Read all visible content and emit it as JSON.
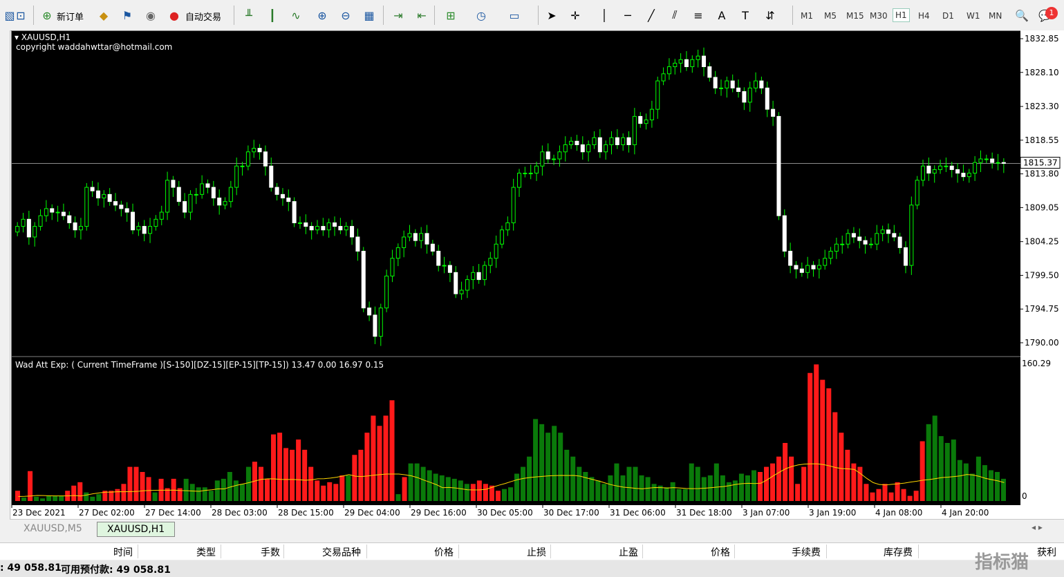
{
  "toolbar": {
    "new_order": "新订单",
    "auto_trade": "自动交易",
    "timeframes": [
      "M1",
      "M5",
      "M15",
      "M30",
      "H1",
      "H4",
      "D1",
      "W1",
      "MN"
    ],
    "active_timeframe": "H1",
    "notification_count": "1"
  },
  "chart": {
    "symbol": "XAUUSD,H1",
    "copyright": "copyright waddahwttar@hotmail.com",
    "current_price": "1815.37",
    "price_ticks": [
      "1832.85",
      "1828.10",
      "1823.30",
      "1818.55",
      "1813.80",
      "1809.05",
      "1804.25",
      "1799.50",
      "1794.75",
      "1790.00"
    ]
  },
  "indicator": {
    "label": "Wad Att Exp: ( Current TimeFrame )[S-150][DZ-15][EP-15][TP-15]) 13.47 0.00 16.97 0.15",
    "max_label": "160.29",
    "min_label": "0"
  },
  "date_axis": [
    "23 Dec 2021",
    "27 Dec 02:00",
    "27 Dec 14:00",
    "28 Dec 03:00",
    "28 Dec 15:00",
    "29 Dec 04:00",
    "29 Dec 16:00",
    "30 Dec 05:00",
    "30 Dec 17:00",
    "31 Dec 06:00",
    "31 Dec 18:00",
    "3 Jan 07:00",
    "3 Jan 19:00",
    "4 Jan 08:00",
    "4 Jan 20:00"
  ],
  "tabs": [
    "XAUUSD,M5",
    "XAUUSD,H1"
  ],
  "active_tab": "XAUUSD,H1",
  "table_columns": [
    "时间",
    "类型",
    "手数",
    "交易品种",
    "价格",
    "止损",
    "止盈",
    "价格",
    "手续费",
    "库存费",
    "获利"
  ],
  "status": {
    "balance_label": ": 49 058.81",
    "free_margin_label": "可用预付款: 49 058.81"
  },
  "watermark": "指标猫",
  "chart_data": {
    "type": "candlestick",
    "price_range": [
      1790.0,
      1832.85
    ],
    "closes": [
      1806.5,
      1807.5,
      1805,
      1806.5,
      1808,
      1809,
      1808.5,
      1808.5,
      1808,
      1807,
      1806,
      1806.5,
      1812,
      1811.5,
      1810.5,
      1811,
      1810,
      1809.5,
      1809,
      1808.5,
      1806,
      1806.5,
      1805.5,
      1806.5,
      1807.5,
      1808.5,
      1813,
      1812,
      1810,
      1808.5,
      1811,
      1811,
      1812.5,
      1812,
      1810.5,
      1809.5,
      1810,
      1812,
      1815,
      1815,
      1817,
      1817.5,
      1817,
      1815,
      1812,
      1811,
      1810.5,
      1810,
      1807,
      1807,
      1806.5,
      1806,
      1806.5,
      1806,
      1807,
      1806.5,
      1806,
      1806.5,
      1805,
      1803,
      1795,
      1794,
      1791,
      1795,
      1799.5,
      1802,
      1803.5,
      1805,
      1805.5,
      1804.5,
      1805.5,
      1804,
      1803,
      1801,
      1801,
      1800,
      1797,
      1797.5,
      1799,
      1800,
      1799,
      1801,
      1802,
      1804,
      1806,
      1807,
      1812,
      1814,
      1814,
      1814,
      1815,
      1817,
      1816,
      1816,
      1817,
      1818,
      1818.5,
      1818,
      1817,
      1818,
      1819,
      1817,
      1818,
      1819,
      1818,
      1819,
      1818,
      1822,
      1821,
      1821.5,
      1823,
      1827,
      1828,
      1829,
      1829.5,
      1830,
      1829,
      1830,
      1830.5,
      1829,
      1827.5,
      1826,
      1826,
      1827,
      1826,
      1825.5,
      1824,
      1826,
      1827,
      1826,
      1823,
      1822,
      1808,
      1803,
      1801,
      1800.5,
      1800,
      1801,
      1800.5,
      1801,
      1802,
      1803,
      1804,
      1804,
      1805.5,
      1805,
      1804.5,
      1804,
      1804,
      1805.5,
      1806,
      1805.5,
      1805,
      1803.5,
      1801,
      1809.5,
      1813,
      1815,
      1814,
      1814.5,
      1815,
      1815,
      1814.5,
      1814,
      1813.5,
      1814,
      1815.5,
      1816,
      1816,
      1815.5,
      1815.5,
      1815.37
    ],
    "histogram": {
      "range": [
        0,
        160.29
      ],
      "values": [
        12,
        4,
        35,
        5,
        3,
        6,
        6,
        6,
        12,
        18,
        22,
        10,
        5,
        8,
        12,
        12,
        14,
        20,
        40,
        40,
        34,
        28,
        10,
        26,
        15,
        26,
        15,
        26,
        20,
        16,
        16,
        12,
        24,
        26,
        34,
        24,
        20,
        40,
        46,
        40,
        26,
        78,
        80,
        62,
        60,
        72,
        60,
        40,
        24,
        18,
        22,
        20,
        30,
        30,
        54,
        60,
        80,
        100,
        88,
        100,
        118,
        8,
        28,
        44,
        44,
        40,
        36,
        32,
        30,
        28,
        26,
        24,
        20,
        20,
        24,
        20,
        18,
        12,
        14,
        16,
        32,
        40,
        52,
        96,
        90,
        80,
        88,
        80,
        60,
        52,
        40,
        34,
        28,
        24,
        20,
        30,
        44,
        30,
        40,
        40,
        30,
        28,
        20,
        18,
        16,
        22,
        14,
        14,
        44,
        40,
        28,
        30,
        44,
        30,
        22,
        24,
        32,
        30,
        36,
        34,
        40,
        44,
        52,
        68,
        52,
        20,
        40,
        150,
        160,
        142,
        132,
        104,
        80,
        60,
        44,
        40,
        20,
        10,
        14,
        20,
        10,
        22,
        14,
        6,
        12,
        70,
        90,
        100,
        76,
        68,
        72,
        48,
        44,
        32,
        52,
        42,
        36,
        34,
        26
      ],
      "colors": [
        "r",
        "g",
        "r",
        "g",
        "g",
        "g",
        "g",
        "g",
        "r",
        "r",
        "r",
        "g",
        "g",
        "g",
        "r",
        "r",
        "r",
        "r",
        "r",
        "r",
        "r",
        "r",
        "g",
        "r",
        "r",
        "r",
        "r",
        "g",
        "g",
        "g",
        "g",
        "g",
        "g",
        "g",
        "g",
        "g",
        "g",
        "g",
        "r",
        "r",
        "r",
        "r",
        "r",
        "r",
        "r",
        "r",
        "r",
        "r",
        "r",
        "r",
        "r",
        "r",
        "r",
        "g",
        "r",
        "r",
        "r",
        "r",
        "r",
        "r",
        "r",
        "g",
        "r",
        "g",
        "g",
        "g",
        "g",
        "g",
        "g",
        "g",
        "g",
        "g",
        "g",
        "r",
        "r",
        "r",
        "r",
        "r",
        "g",
        "g",
        "g",
        "g",
        "g",
        "g",
        "g",
        "g",
        "g",
        "g",
        "g",
        "g",
        "g",
        "g",
        "g",
        "g",
        "g",
        "g",
        "g",
        "g",
        "g",
        "g",
        "g",
        "g",
        "g",
        "g",
        "g",
        "g",
        "g",
        "g",
        "g",
        "g",
        "g",
        "g",
        "g",
        "g",
        "g",
        "g",
        "g",
        "g",
        "g",
        "r",
        "r",
        "r",
        "r",
        "r",
        "r",
        "r",
        "r",
        "r",
        "r",
        "r",
        "r",
        "r",
        "r",
        "r",
        "r",
        "r",
        "r",
        "r",
        "r",
        "r",
        "r",
        "r",
        "r",
        "r",
        "r",
        "r",
        "g",
        "g",
        "g",
        "g",
        "g",
        "g",
        "g",
        "g",
        "g",
        "g",
        "g",
        "g",
        "g",
        "g"
      ]
    }
  }
}
